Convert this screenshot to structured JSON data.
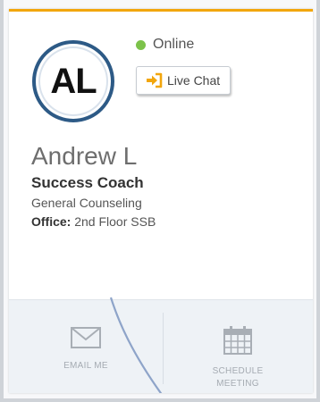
{
  "coach": {
    "initials": "AL",
    "name": "Andrew L",
    "role": "Success Coach",
    "department": "General Counseling",
    "office_label": "Office:",
    "office_value": " 2nd Floor SSB"
  },
  "status": {
    "text": "Online",
    "color": "#7cc24a"
  },
  "chat": {
    "label": "Live Chat",
    "icon": "sign-in-icon",
    "icon_color": "#f2a60d"
  },
  "actions": {
    "email_label": "EMAIL ME",
    "email_icon": "envelope-icon",
    "schedule_label": "SCHEDULE MEETING",
    "schedule_icon": "calendar-icon"
  },
  "colors": {
    "accent": "#f2a60d",
    "avatar_ring": "#2d5a86",
    "swoosh": "#8ea4c9"
  }
}
